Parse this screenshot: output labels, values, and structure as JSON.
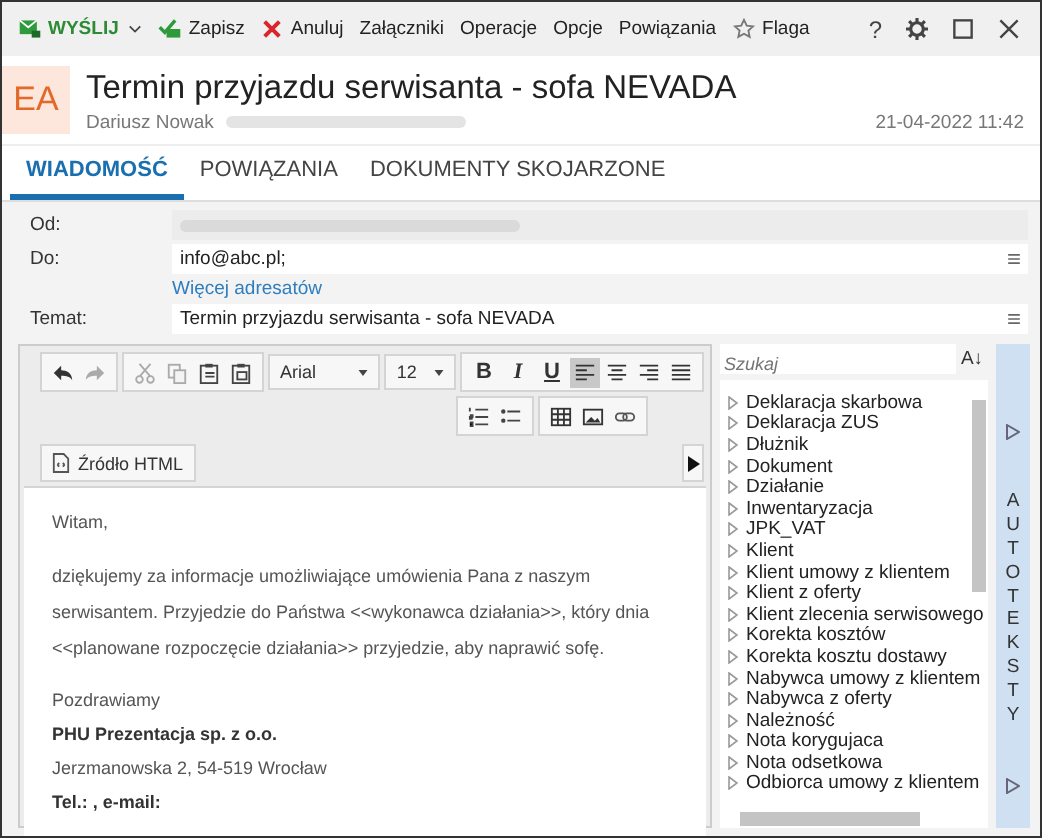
{
  "toolbar": {
    "items": [
      {
        "kind": "send",
        "label": "WYŚLIJ"
      },
      {
        "kind": "save",
        "label": "Zapisz"
      },
      {
        "kind": "cancel",
        "label": "Anuluj"
      },
      {
        "kind": "plain",
        "label": "Załączniki"
      },
      {
        "kind": "plain",
        "label": "Operacje"
      },
      {
        "kind": "plain",
        "label": "Opcje"
      },
      {
        "kind": "plain",
        "label": "Powiązania"
      },
      {
        "kind": "flag",
        "label": "Flaga"
      }
    ],
    "help": "?"
  },
  "header": {
    "avatar": "EA",
    "title": "Termin przyjazdu serwisanta - sofa NEVADA",
    "sender": "Dariusz Nowak",
    "date": "21-04-2022 11:42"
  },
  "tabs": [
    {
      "label": "WIADOMOŚĆ",
      "selected": true
    },
    {
      "label": "POWIĄZANIA",
      "selected": false
    },
    {
      "label": "DOKUMENTY SKOJARZONE",
      "selected": false
    }
  ],
  "form": {
    "from_label": "Od:",
    "to_label": "Do:",
    "to_value": "info@abc.pl;",
    "more_link": "Więcej adresatów",
    "subject_label": "Temat:",
    "subject_value": "Termin przyjazdu serwisanta - sofa NEVADA"
  },
  "editor": {
    "font": "Arial",
    "size": "12",
    "bold": "B",
    "italic": "I",
    "underline": "U",
    "align": [
      {
        "kind": "left",
        "selected": true
      },
      {
        "kind": "center",
        "selected": false
      },
      {
        "kind": "right",
        "selected": false
      },
      {
        "kind": "justify",
        "selected": false
      }
    ],
    "source_button": "Źródło HTML",
    "body": [
      {
        "kind": "para",
        "text": "Witam,"
      },
      {
        "kind": "para",
        "text": "dziękujemy za informacje umożliwiające umówienia Pana z naszym serwisantem. Przyjedzie do Państwa <<wykonawca działania>>, który dnia <<planowane rozpoczęcie działania>> przyjedzie, aby naprawić sofę."
      }
    ],
    "signature": [
      {
        "text": "Pozdrawiamy",
        "bold": false
      },
      {
        "text": "PHU Prezentacja sp. z o.o.",
        "bold": true
      },
      {
        "text": "Jerzmanowska 2, 54-519 Wrocław",
        "bold": false
      },
      {
        "text": "Tel.: , e-mail:",
        "bold": true
      }
    ]
  },
  "autotexts": {
    "search_placeholder": "Szukaj",
    "sort_button": "A↓",
    "tab_label": "AUTOTEKSTY",
    "items": [
      "Deklaracja skarbowa",
      "Deklaracja ZUS",
      "Dłużnik",
      "Dokument",
      "Działanie",
      "Inwentaryzacja",
      "JPK_VAT",
      "Klient",
      "Klient umowy z klientem",
      "Klient z oferty",
      "Klient zlecenia serwisowego",
      "Korekta kosztów",
      "Korekta kosztu dostawy",
      "Nabywca umowy z klientem",
      "Nabywca z oferty",
      "Należność",
      "Nota korygujaca",
      "Nota odsetkowa",
      "Odbiorca umowy z klientem"
    ]
  }
}
